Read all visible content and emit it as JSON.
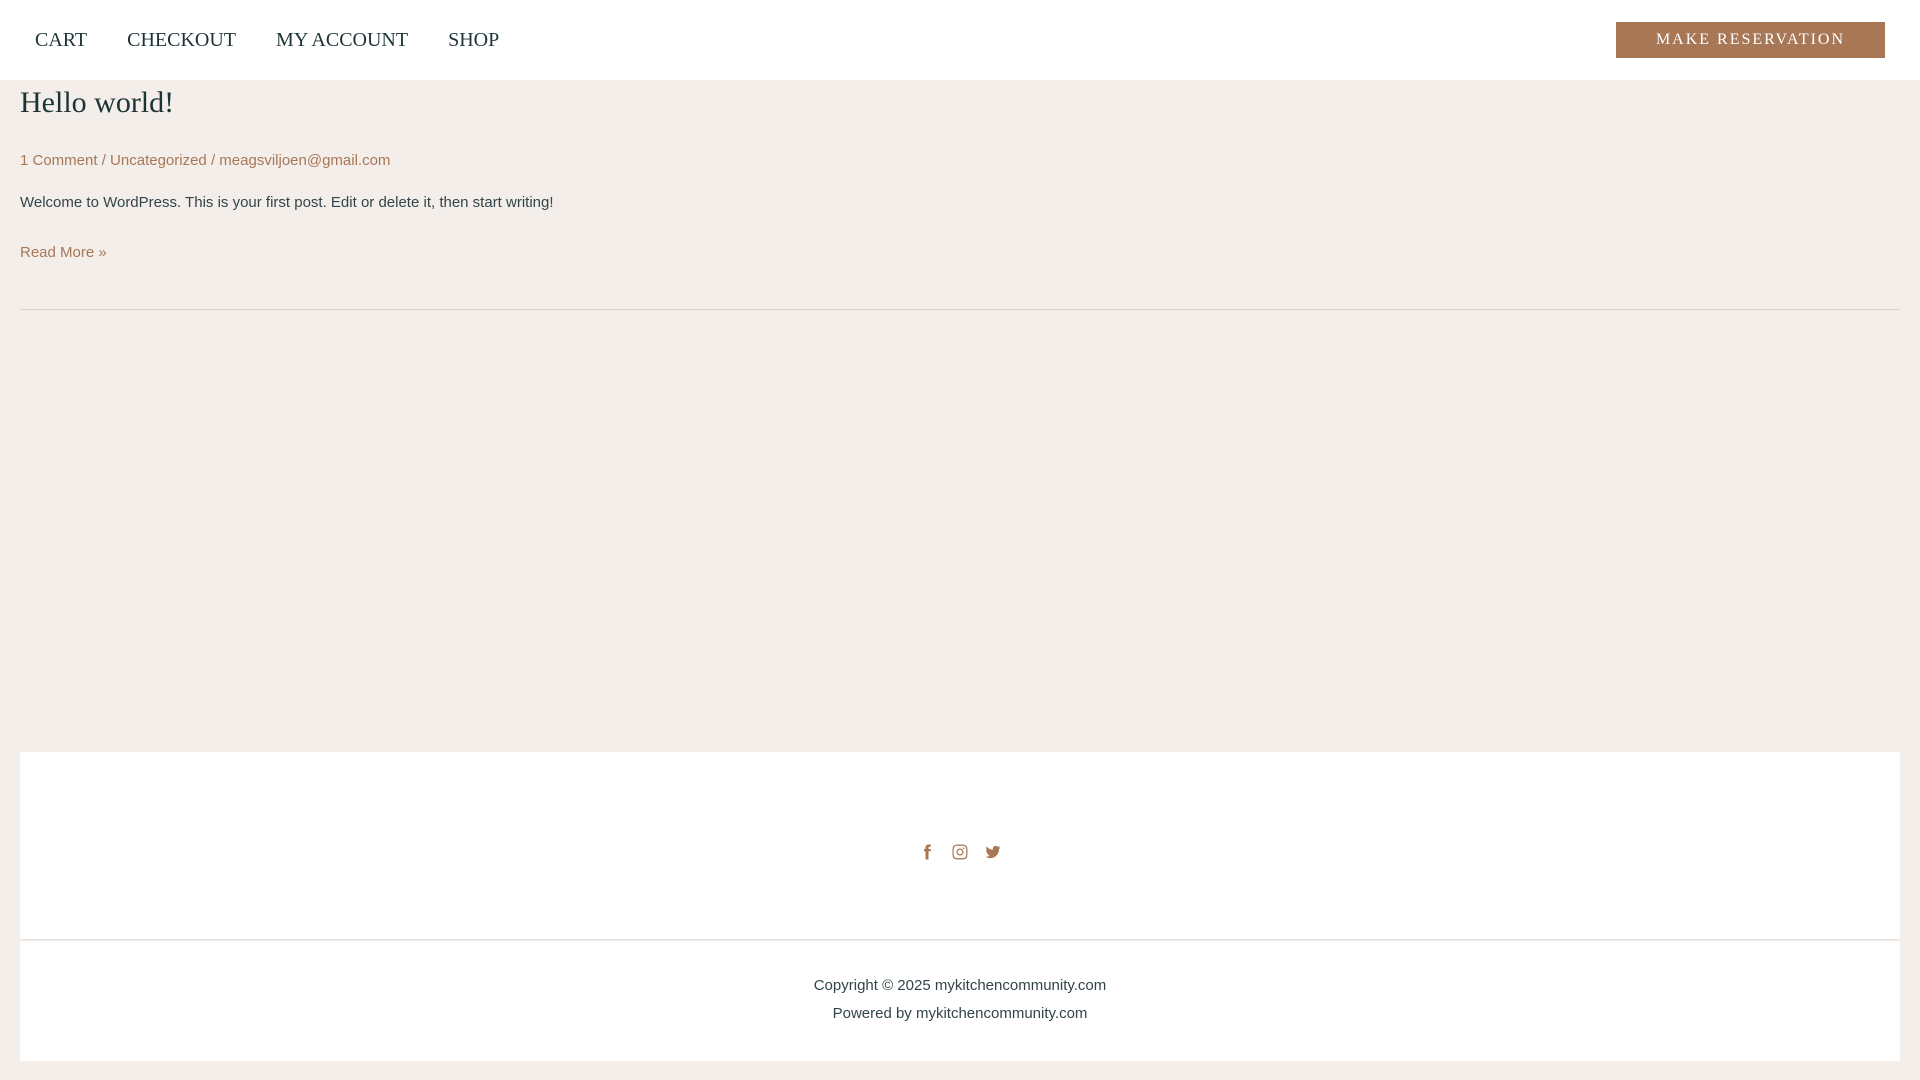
{
  "nav": {
    "items": [
      {
        "label": "CART"
      },
      {
        "label": "CHECKOUT"
      },
      {
        "label": "MY ACCOUNT"
      },
      {
        "label": "SHOP"
      }
    ],
    "cta_label": "MAKE RESERVATION"
  },
  "post": {
    "title": "Hello world!",
    "meta": {
      "comments": "1 Comment",
      "separator": "/",
      "category": "Uncategorized",
      "author": "meagsviljoen@gmail.com"
    },
    "excerpt": "Welcome to WordPress. This is your first post. Edit or delete it, then start writing!",
    "read_more": "Read More »"
  },
  "footer": {
    "social_icons": [
      "facebook-icon",
      "instagram-icon",
      "twitter-icon"
    ],
    "copyright": "Copyright © 2025 mykitchencommunity.com",
    "powered": "Powered by mykitchencommunity.com"
  },
  "colors": {
    "accent": "#a77756",
    "background": "#f3eeea",
    "heading": "#1d3436",
    "text": "#33454a"
  }
}
